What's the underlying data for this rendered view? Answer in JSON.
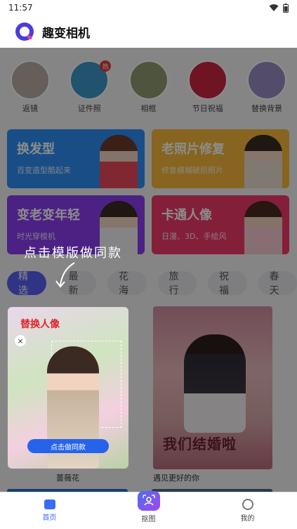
{
  "status_bar": {
    "time": "11:57"
  },
  "app": {
    "title": "趣变相机"
  },
  "features": [
    {
      "label": "返镜",
      "hot": false,
      "color": "#b8aba3"
    },
    {
      "label": "证件照",
      "hot": true,
      "hot_label": "热",
      "color": "#3d97c9"
    },
    {
      "label": "相框",
      "hot": false,
      "color": "#8e9a71"
    },
    {
      "label": "节日祝福",
      "hot": false,
      "color": "#c8263e"
    },
    {
      "label": "替换背景",
      "hot": false,
      "color": "#9a8bc4"
    }
  ],
  "cards": [
    {
      "title": "换发型",
      "subtitle": "百变造型酷起来",
      "color": "#2f8cf5"
    },
    {
      "title": "老照片修复",
      "subtitle": "修复模糊破损照片",
      "color": "#f6b63a"
    },
    {
      "title": "变老变年轻",
      "subtitle": "时光穿梭机",
      "color": "#8a3df0"
    },
    {
      "title": "卡通人像",
      "subtitle": "日漫、3D、手绘风",
      "color": "#f03a6b"
    }
  ],
  "category_tabs": [
    "精选",
    "最新",
    "花海",
    "旅行",
    "祝福",
    "春天"
  ],
  "active_tab": "精选",
  "tip_text": "点击模版做同款",
  "templates": [
    {
      "label": "替换人像",
      "button": "点击做同款",
      "close": "×",
      "caption": "蔷薇花"
    },
    {
      "text": "我们结婚啦",
      "caption": "遇见更好的你"
    }
  ],
  "bottom_nav": [
    {
      "label": "首页",
      "active": true
    },
    {
      "label": "抠图",
      "active": false
    },
    {
      "label": "我的",
      "active": false
    }
  ]
}
